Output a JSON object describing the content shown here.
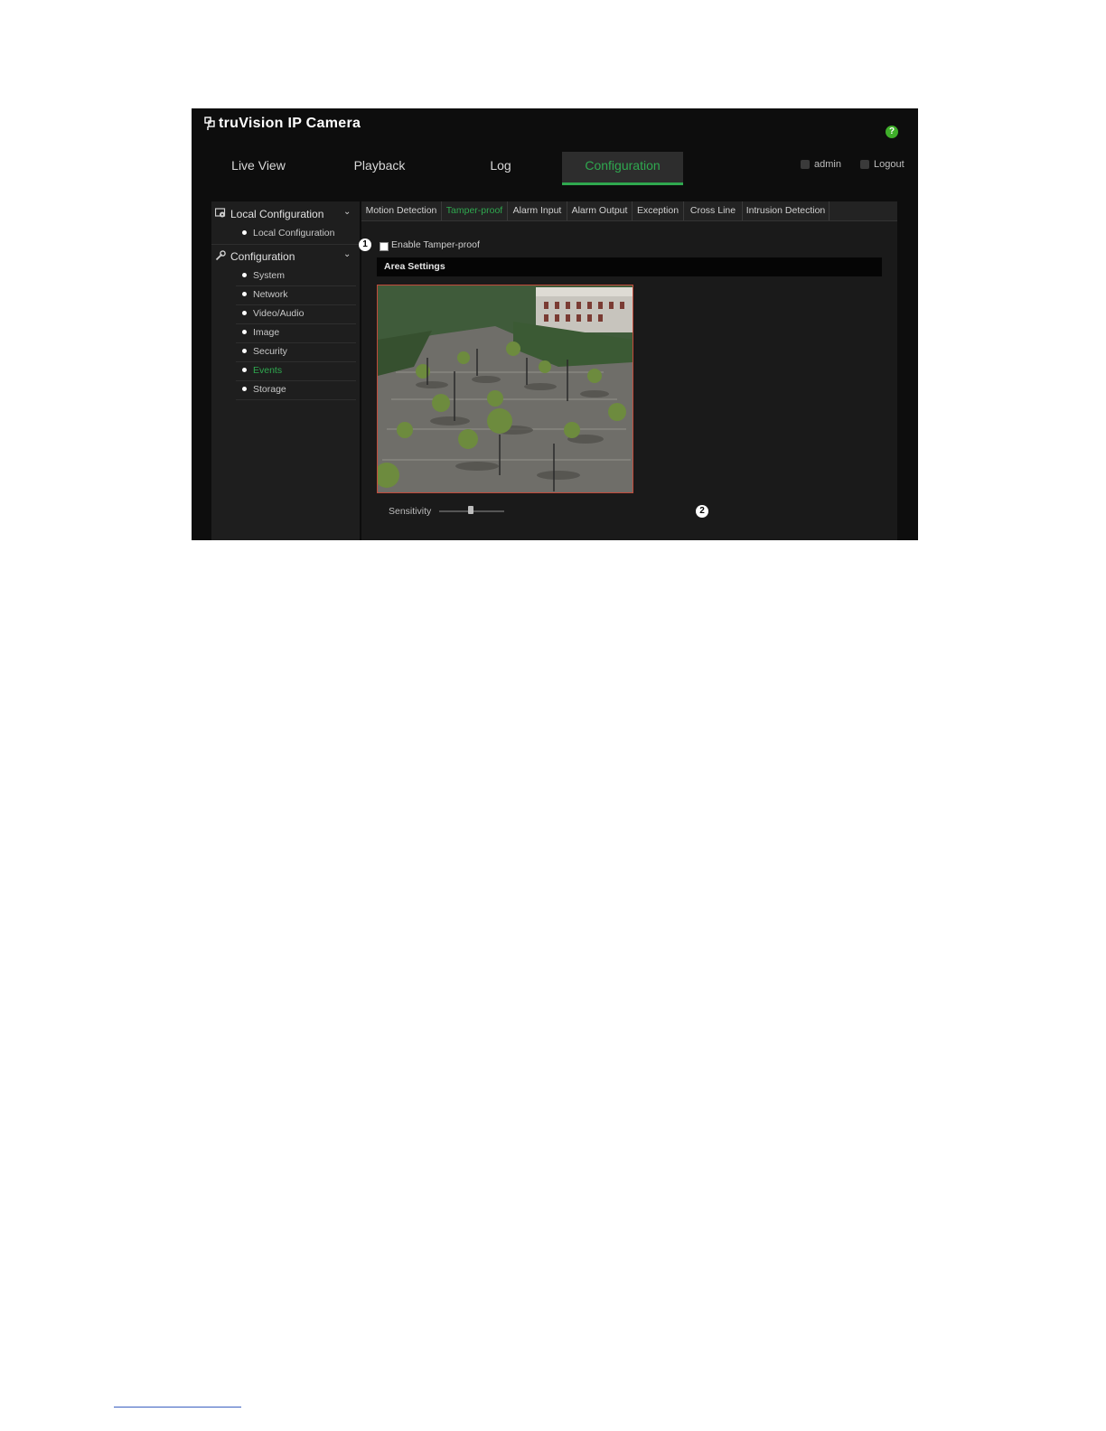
{
  "app": {
    "title": "truVision IP Camera"
  },
  "nav": {
    "tabs": [
      {
        "label": "Live View"
      },
      {
        "label": "Playback"
      },
      {
        "label": "Log"
      },
      {
        "label": "Configuration",
        "active": true
      }
    ],
    "user": "admin",
    "logout": "Logout"
  },
  "sidebar": {
    "sections": [
      {
        "label": "Local Configuration",
        "items": [
          {
            "label": "Local Configuration"
          }
        ]
      },
      {
        "label": "Configuration",
        "items": [
          {
            "label": "System"
          },
          {
            "label": "Network"
          },
          {
            "label": "Video/Audio"
          },
          {
            "label": "Image"
          },
          {
            "label": "Security"
          },
          {
            "label": "Events",
            "active": true
          },
          {
            "label": "Storage"
          }
        ]
      }
    ]
  },
  "subtabs": [
    {
      "label": "Motion Detection"
    },
    {
      "label": "Tamper-proof",
      "active": true
    },
    {
      "label": "Alarm Input"
    },
    {
      "label": "Alarm Output"
    },
    {
      "label": "Exception"
    },
    {
      "label": "Cross Line"
    },
    {
      "label": "Intrusion Detection"
    }
  ],
  "tamper": {
    "enable_label": "Enable Tamper-proof",
    "enabled": false,
    "area_settings": "Area Settings",
    "sensitivity_label": "Sensitivity",
    "sensitivity_level": 0.48
  },
  "callouts": {
    "one": "1",
    "two": "2"
  },
  "colors": {
    "accent": "#2fa84f",
    "background": "#0d0d0d",
    "panel": "#1a1a1a"
  }
}
